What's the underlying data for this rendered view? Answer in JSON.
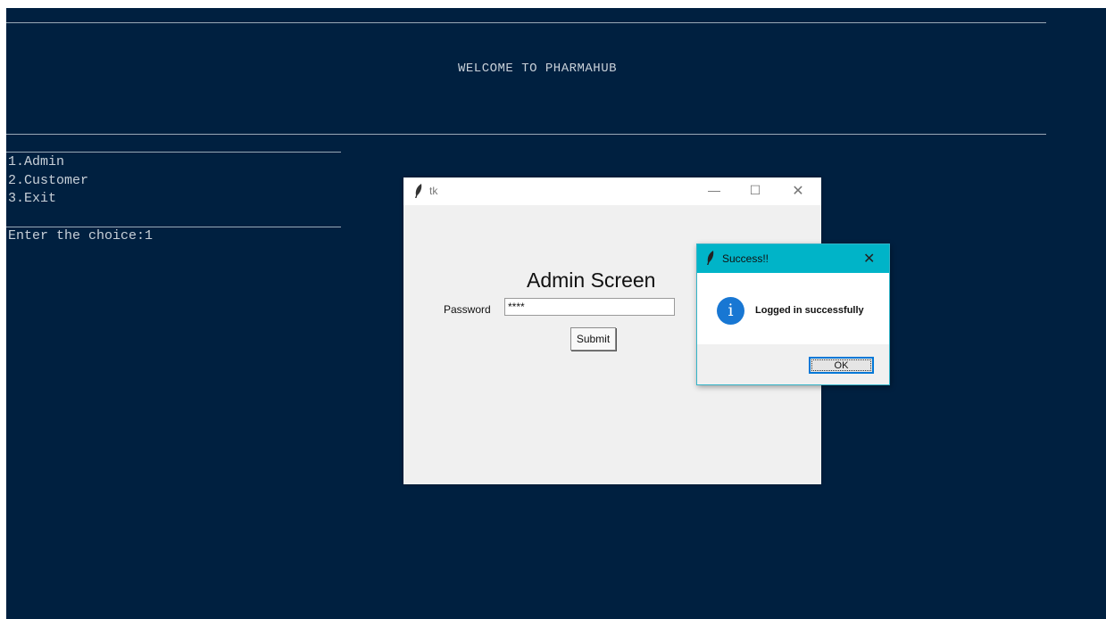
{
  "console": {
    "banner": "WELCOME TO PHARMAHUB",
    "menu": [
      "1.Admin",
      "2.Customer",
      "3.Exit"
    ],
    "prompt": "Enter the choice:1"
  },
  "tk_window": {
    "title": "tk",
    "title_icon": "feather-icon",
    "heading": "Admin Screen",
    "password_label": "Password",
    "password_value": "****",
    "submit_label": "Submit",
    "controls": {
      "minimize": "—",
      "maximize": "☐",
      "close": "✕"
    }
  },
  "message_box": {
    "title": "Success!!",
    "title_icon": "feather-icon",
    "close": "✕",
    "icon": "info-icon",
    "icon_glyph": "i",
    "message": "Logged in successfully",
    "ok_label": "OK"
  },
  "colors": {
    "console_bg": "#002040",
    "message_titlebar": "#00b4c8",
    "info_icon": "#1877d3"
  }
}
